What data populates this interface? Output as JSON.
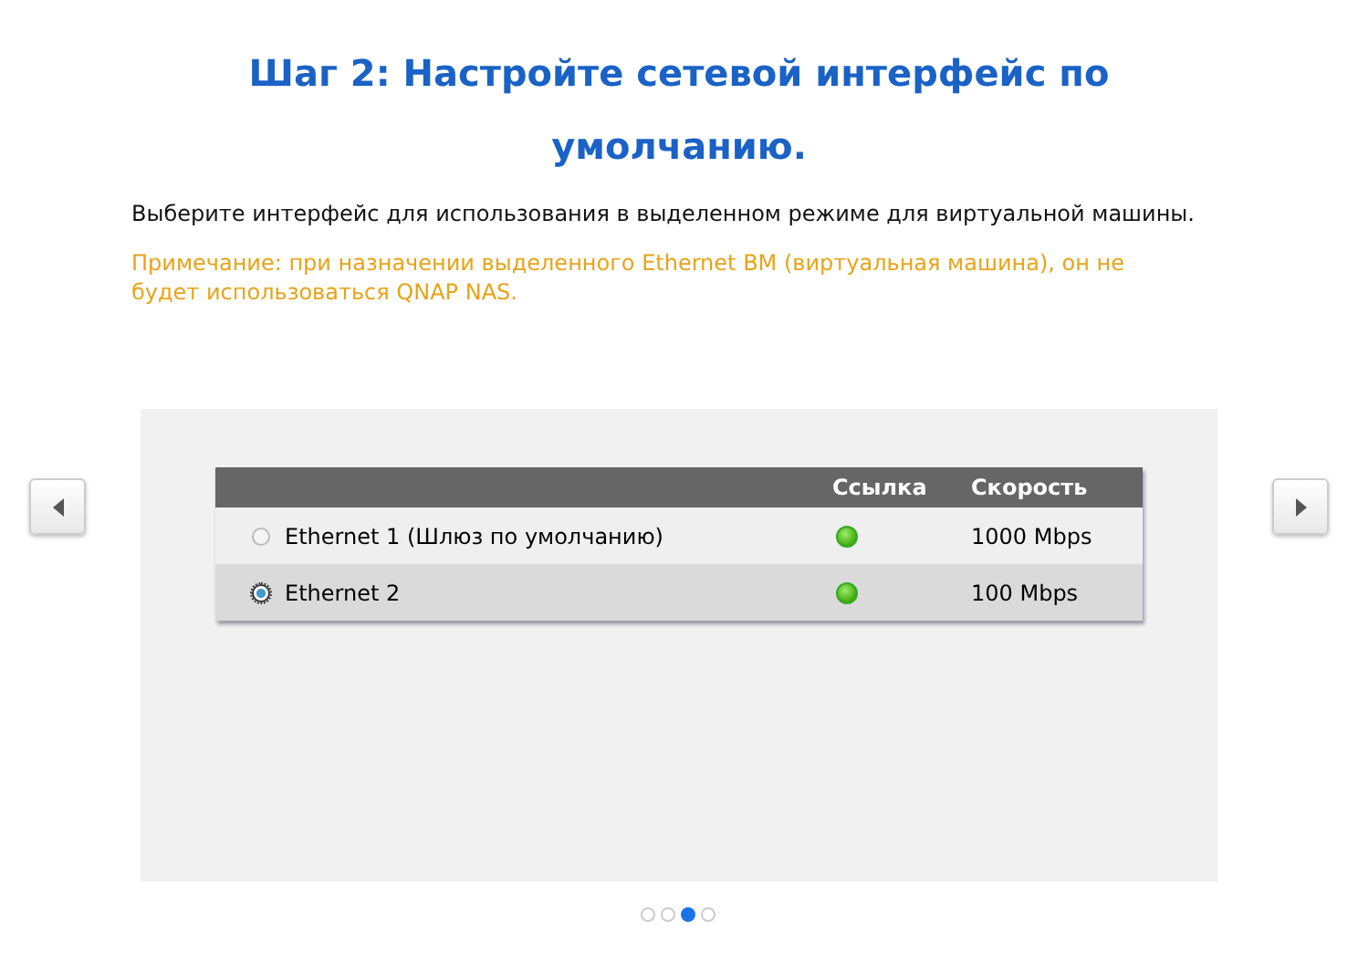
{
  "title": "Шаг 2: Настройте сетевой интерфейс по умолчанию.",
  "instruction": "Выберите интерфейс для использования в выделенном режиме для виртуальной машины.",
  "note": "Примечание: при назначении выделенного Ethernet ВМ (виртуальная машина), он не будет использоваться QNAP NAS.",
  "table": {
    "columns": [
      "Ссылка",
      "Скорость"
    ],
    "rows": [
      {
        "name": "Ethernet 1 (Шлюз по умолчанию)",
        "selected": false,
        "link_up": true,
        "speed": "1000 Mbps"
      },
      {
        "name": "Ethernet 2",
        "selected": true,
        "link_up": true,
        "speed": "100 Mbps"
      }
    ]
  },
  "pager": [
    {
      "selected": false
    },
    {
      "selected": false
    },
    {
      "selected": true
    },
    {
      "selected": false
    }
  ]
}
